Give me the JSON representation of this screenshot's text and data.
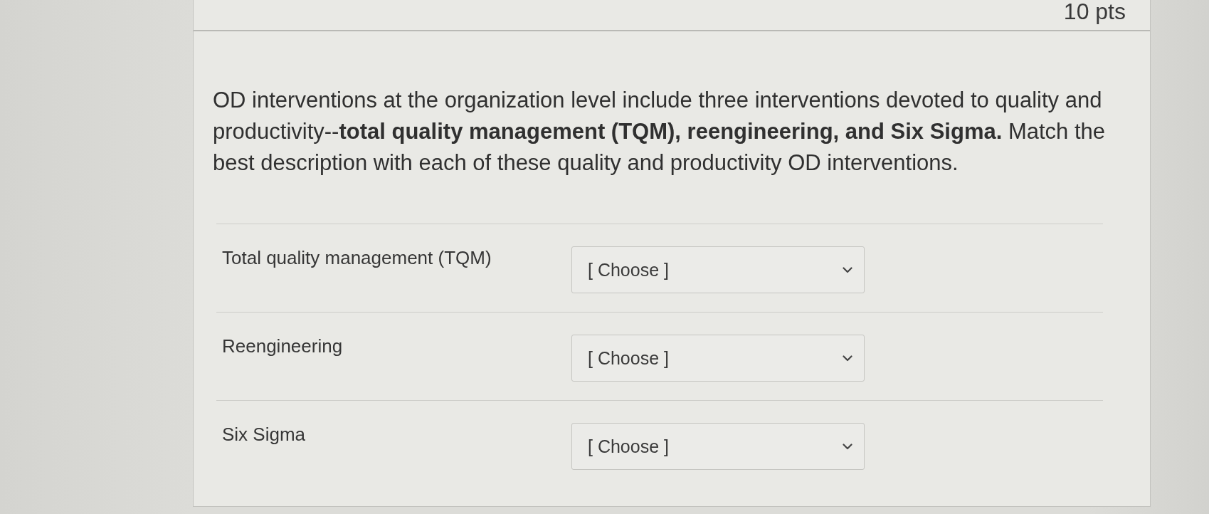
{
  "card": {
    "points": "10 pts"
  },
  "question": {
    "text": "OD interventions at the organization level include three interventions devoted to quality and productivity--**total quality management (TQM), reengineering, and Six Sigma.** Match the best description with each of these quality and productivity OD interventions."
  },
  "matches": [
    {
      "prompt": "Total quality management (TQM)",
      "answer": "[ Choose ]"
    },
    {
      "prompt": "Reengineering",
      "answer": "[ Choose ]"
    },
    {
      "prompt": "Six Sigma",
      "answer": "[ Choose ]"
    }
  ]
}
